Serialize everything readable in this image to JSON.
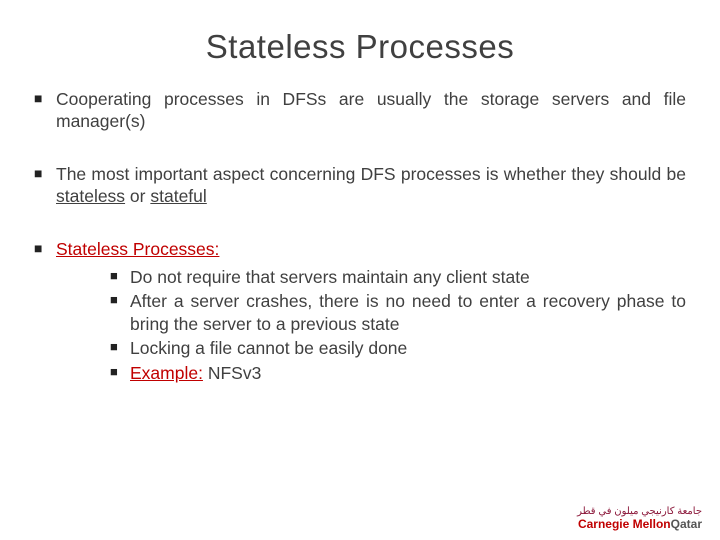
{
  "title": "Stateless Processes",
  "bullets": {
    "b1": "Cooperating processes in DFSs are usually the storage servers and file manager(s)",
    "b2_pre": "The most important aspect concerning DFS processes is whether they should be ",
    "b2_u1": "stateless",
    "b2_mid": " or ",
    "b2_u2": "stateful",
    "b3_label": "Stateless Processes:",
    "b3_s1": "Do not require that servers maintain any client state",
    "b3_s2": "After a server crashes, there is no need to enter a recovery phase to bring the server to a previous state",
    "b3_s3": "Locking a file cannot be easily done",
    "b3_s4_label": "Example:",
    "b3_s4_val": " NFSv3"
  },
  "logo": {
    "arabic": "جامعة كارنيجي ميلون في قطر",
    "line1": "Carnegie Mellon",
    "line2": "Qatar"
  }
}
